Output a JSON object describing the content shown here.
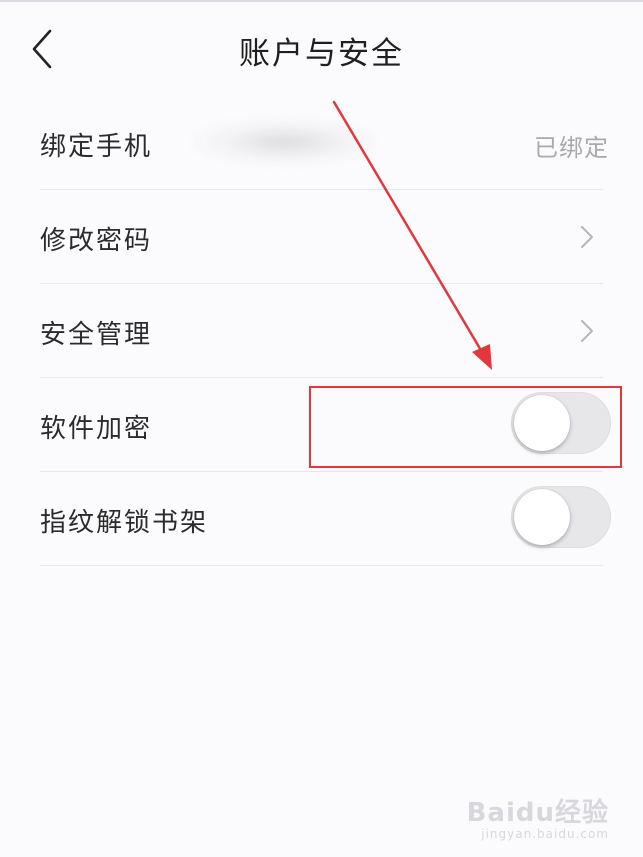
{
  "header": {
    "title": "账户与安全",
    "back_icon": "chevron-left-icon"
  },
  "settings": [
    {
      "label": "绑定手机",
      "value": "已绑定",
      "control": "value"
    },
    {
      "label": "修改密码",
      "control": "chevron-right-icon"
    },
    {
      "label": "安全管理",
      "control": "chevron-right-icon"
    },
    {
      "label": "软件加密",
      "control": "toggle",
      "toggle_on": false
    },
    {
      "label": "指纹解锁书架",
      "control": "toggle",
      "toggle_on": false
    }
  ],
  "watermark": {
    "brand": "Baidu经验",
    "url": "jingyan.baidu.com"
  },
  "colors": {
    "annotation": "#e0383d",
    "background": "#fbfbfd"
  }
}
